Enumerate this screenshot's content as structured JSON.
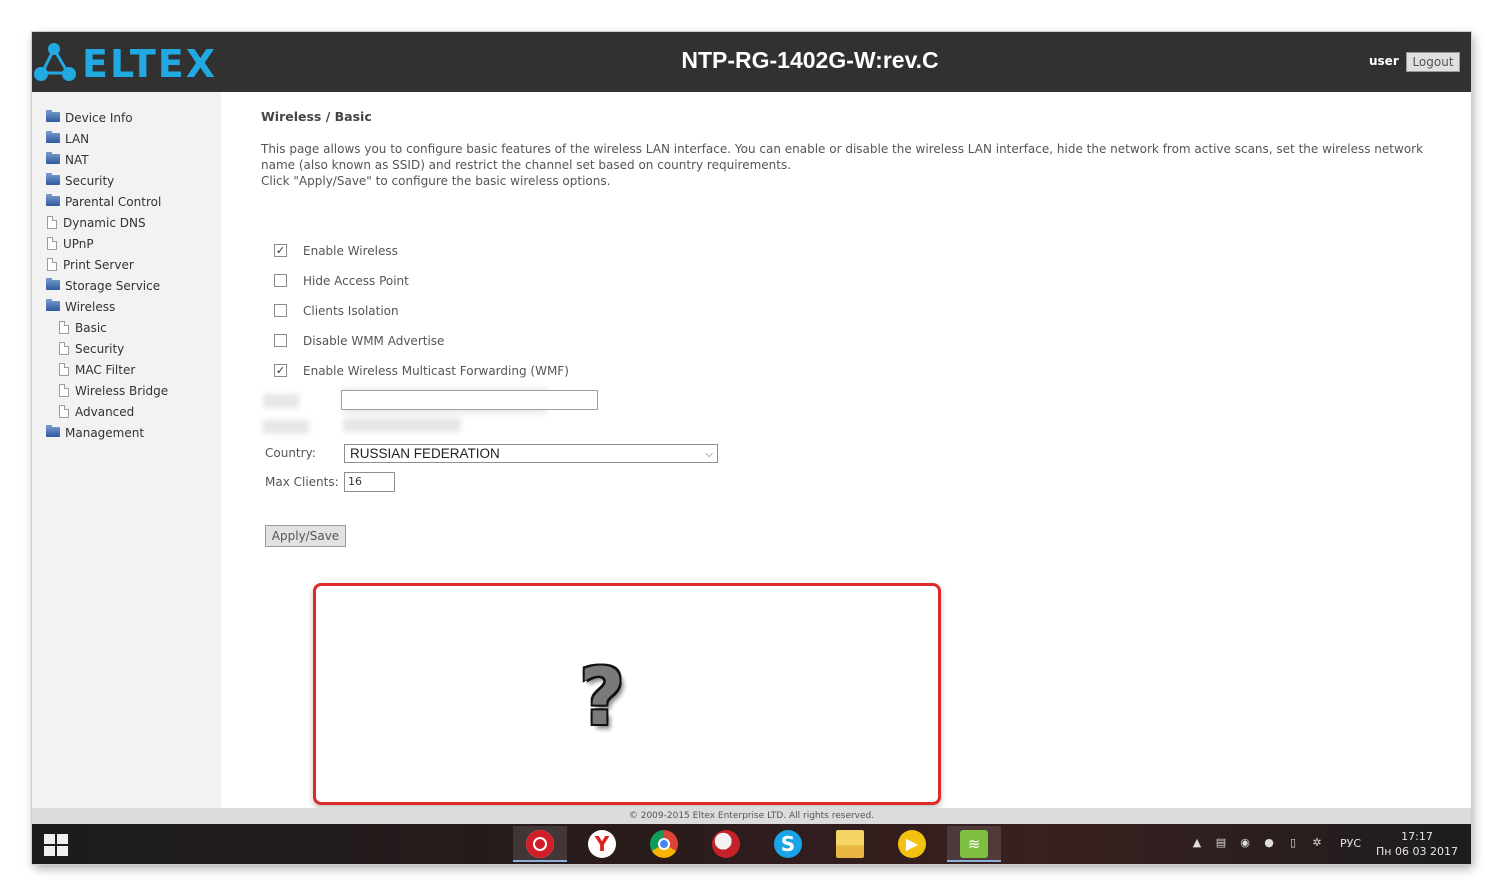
{
  "header": {
    "logo_text": "ELTEX",
    "device_title": "NTP-RG-1402G-W:rev.C",
    "user_label": "user",
    "logout_label": "Logout"
  },
  "sidebar": {
    "items": [
      {
        "label": "Device Info",
        "icon": "folder-icon"
      },
      {
        "label": "LAN",
        "icon": "folder-icon"
      },
      {
        "label": "NAT",
        "icon": "folder-icon"
      },
      {
        "label": "Security",
        "icon": "folder-icon"
      },
      {
        "label": "Parental Control",
        "icon": "folder-icon"
      },
      {
        "label": "Dynamic DNS",
        "icon": "page-icon"
      },
      {
        "label": "UPnP",
        "icon": "page-icon"
      },
      {
        "label": "Print Server",
        "icon": "page-icon"
      },
      {
        "label": "Storage Service",
        "icon": "folder-icon"
      },
      {
        "label": "Wireless",
        "icon": "folder-icon"
      },
      {
        "label": "Basic",
        "icon": "page-icon"
      },
      {
        "label": "Security",
        "icon": "page-icon"
      },
      {
        "label": "MAC Filter",
        "icon": "page-icon"
      },
      {
        "label": "Wireless Bridge",
        "icon": "page-icon"
      },
      {
        "label": "Advanced",
        "icon": "page-icon"
      },
      {
        "label": "Management",
        "icon": "folder-icon"
      }
    ]
  },
  "main": {
    "heading": "Wireless / Basic",
    "description_line1": "This page allows you to configure basic features of the wireless LAN interface. You can enable or disable the wireless LAN interface, hide the network from active scans, set the wireless network name (also known as SSID) and restrict the channel set based on country requirements.",
    "description_line2": "Click \"Apply/Save\" to configure the basic wireless options.",
    "checkboxes": [
      {
        "label": "Enable Wireless",
        "checked": true
      },
      {
        "label": "Hide Access Point",
        "checked": false
      },
      {
        "label": "Clients Isolation",
        "checked": false
      },
      {
        "label": "Disable WMM Advertise",
        "checked": false
      },
      {
        "label": "Enable Wireless Multicast Forwarding (WMF)",
        "checked": true
      }
    ],
    "country_label": "Country:",
    "country_value": "RUSSIAN FEDERATION",
    "max_clients_label": "Max Clients:",
    "max_clients_value": "16",
    "apply_label": "Apply/Save",
    "placeholder_symbol": "?"
  },
  "footer": {
    "copyright": "© 2009-2015 Eltex Enterprise LTD. All rights reserved."
  },
  "taskbar": {
    "apps": [
      "opera-icon",
      "yandex-icon",
      "chrome-icon",
      "comodo-icon",
      "skype-icon",
      "file-explorer-icon",
      "media-player-icon",
      "wifi-app-icon"
    ],
    "language": "РУС",
    "time": "17:17",
    "date": "Пн 06 03 2017"
  },
  "colors": {
    "header_bg": "#313131",
    "logo_blue": "#23a9e1",
    "highlight_red": "#de2a2a"
  }
}
